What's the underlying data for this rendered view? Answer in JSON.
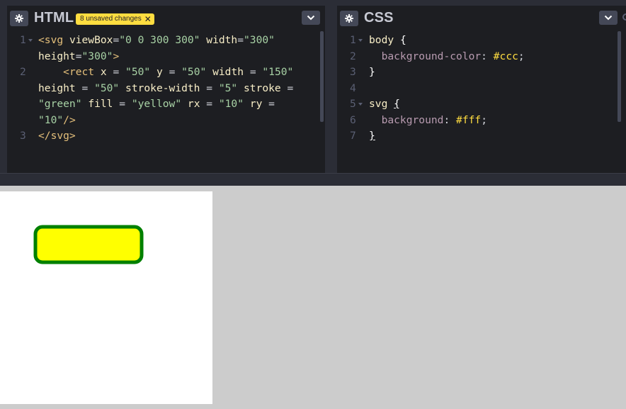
{
  "html_panel": {
    "title": "HTML",
    "badge_text": "8 unsaved changes",
    "badge_close": "✕",
    "lines": [
      {
        "num": "1",
        "fold": true,
        "parts": [
          {
            "c": "t-tag",
            "t": "<svg "
          },
          {
            "c": "t-attr",
            "t": "viewBox"
          },
          {
            "c": "t-plain",
            "t": "="
          },
          {
            "c": "t-str",
            "t": "\"0 0 300 300\""
          },
          {
            "c": "t-plain",
            "t": " "
          },
          {
            "c": "t-attr",
            "t": "width"
          },
          {
            "c": "t-plain",
            "t": "="
          },
          {
            "c": "t-str",
            "t": "\"300\""
          }
        ]
      },
      {
        "num": "",
        "fold": false,
        "parts": [
          {
            "c": "t-attr",
            "t": "height"
          },
          {
            "c": "t-plain",
            "t": "="
          },
          {
            "c": "t-str",
            "t": "\"300\""
          },
          {
            "c": "t-tag",
            "t": ">"
          }
        ]
      },
      {
        "num": "2",
        "fold": false,
        "parts": [
          {
            "c": "t-plain",
            "t": "    "
          },
          {
            "c": "t-tag",
            "t": "<rect "
          },
          {
            "c": "t-attr",
            "t": "x"
          },
          {
            "c": "t-plain",
            "t": " = "
          },
          {
            "c": "t-str",
            "t": "\"50\""
          },
          {
            "c": "t-plain",
            "t": " "
          },
          {
            "c": "t-attr",
            "t": "y"
          },
          {
            "c": "t-plain",
            "t": " = "
          },
          {
            "c": "t-str",
            "t": "\"50\""
          },
          {
            "c": "t-plain",
            "t": " "
          },
          {
            "c": "t-attr",
            "t": "width"
          },
          {
            "c": "t-plain",
            "t": " = "
          },
          {
            "c": "t-str",
            "t": "\"150\""
          }
        ]
      },
      {
        "num": "",
        "fold": false,
        "parts": [
          {
            "c": "t-attr",
            "t": "height"
          },
          {
            "c": "t-plain",
            "t": " = "
          },
          {
            "c": "t-str",
            "t": "\"50\""
          },
          {
            "c": "t-plain",
            "t": " "
          },
          {
            "c": "t-attr",
            "t": "stroke-width"
          },
          {
            "c": "t-plain",
            "t": " = "
          },
          {
            "c": "t-str",
            "t": "\"5\""
          },
          {
            "c": "t-plain",
            "t": " "
          },
          {
            "c": "t-attr",
            "t": "stroke"
          },
          {
            "c": "t-plain",
            "t": " ="
          }
        ]
      },
      {
        "num": "",
        "fold": false,
        "parts": [
          {
            "c": "t-str",
            "t": "\"green\""
          },
          {
            "c": "t-plain",
            "t": " "
          },
          {
            "c": "t-attr",
            "t": "fill"
          },
          {
            "c": "t-plain",
            "t": " = "
          },
          {
            "c": "t-str",
            "t": "\"yellow\""
          },
          {
            "c": "t-plain",
            "t": " "
          },
          {
            "c": "t-attr",
            "t": "rx"
          },
          {
            "c": "t-plain",
            "t": " = "
          },
          {
            "c": "t-str",
            "t": "\"10\""
          },
          {
            "c": "t-plain",
            "t": " "
          },
          {
            "c": "t-attr",
            "t": "ry"
          },
          {
            "c": "t-plain",
            "t": " ="
          }
        ]
      },
      {
        "num": "",
        "fold": false,
        "parts": [
          {
            "c": "t-str",
            "t": "\"10\""
          },
          {
            "c": "t-tag",
            "t": "/>"
          }
        ]
      },
      {
        "num": "3",
        "fold": false,
        "parts": [
          {
            "c": "t-tag",
            "t": "</svg>"
          }
        ]
      }
    ]
  },
  "css_panel": {
    "title": "CSS",
    "lines": [
      {
        "num": "1",
        "fold": true,
        "parts": [
          {
            "c": "t-sel",
            "t": "body"
          },
          {
            "c": "t-plain",
            "t": " "
          },
          {
            "c": "t-brace",
            "t": "{"
          }
        ]
      },
      {
        "num": "2",
        "fold": false,
        "parts": [
          {
            "c": "t-plain",
            "t": "  "
          },
          {
            "c": "t-prop",
            "t": "background-color"
          },
          {
            "c": "t-plain",
            "t": ": "
          },
          {
            "c": "t-val",
            "t": "#ccc"
          },
          {
            "c": "t-plain",
            "t": ";"
          }
        ]
      },
      {
        "num": "3",
        "fold": false,
        "parts": [
          {
            "c": "t-brace",
            "t": "}"
          }
        ]
      },
      {
        "num": "4",
        "fold": false,
        "parts": []
      },
      {
        "num": "5",
        "fold": true,
        "parts": [
          {
            "c": "t-sel",
            "t": "svg"
          },
          {
            "c": "t-plain",
            "t": " "
          },
          {
            "c": "t-brace underline",
            "t": "{"
          }
        ]
      },
      {
        "num": "6",
        "fold": false,
        "parts": [
          {
            "c": "t-plain",
            "t": "  "
          },
          {
            "c": "t-prop",
            "t": "background"
          },
          {
            "c": "t-plain",
            "t": ": "
          },
          {
            "c": "t-val",
            "t": "#fff"
          },
          {
            "c": "t-plain",
            "t": ";"
          }
        ]
      },
      {
        "num": "7",
        "fold": false,
        "parts": [
          {
            "c": "t-brace underline",
            "t": "}"
          }
        ]
      }
    ]
  },
  "preview": {
    "body_bg": "#cccccc",
    "svg_bg": "#ffffff",
    "rect_fill": "#ffff00",
    "rect_stroke": "#008000"
  },
  "colors": {
    "badge_bg": "#ffdd40",
    "editor_bg": "#1d1e22",
    "chrome": "#2b2d36"
  },
  "icons": {
    "settings": "gear-icon",
    "dropdown": "chevron-down-icon",
    "close": "close-icon"
  }
}
